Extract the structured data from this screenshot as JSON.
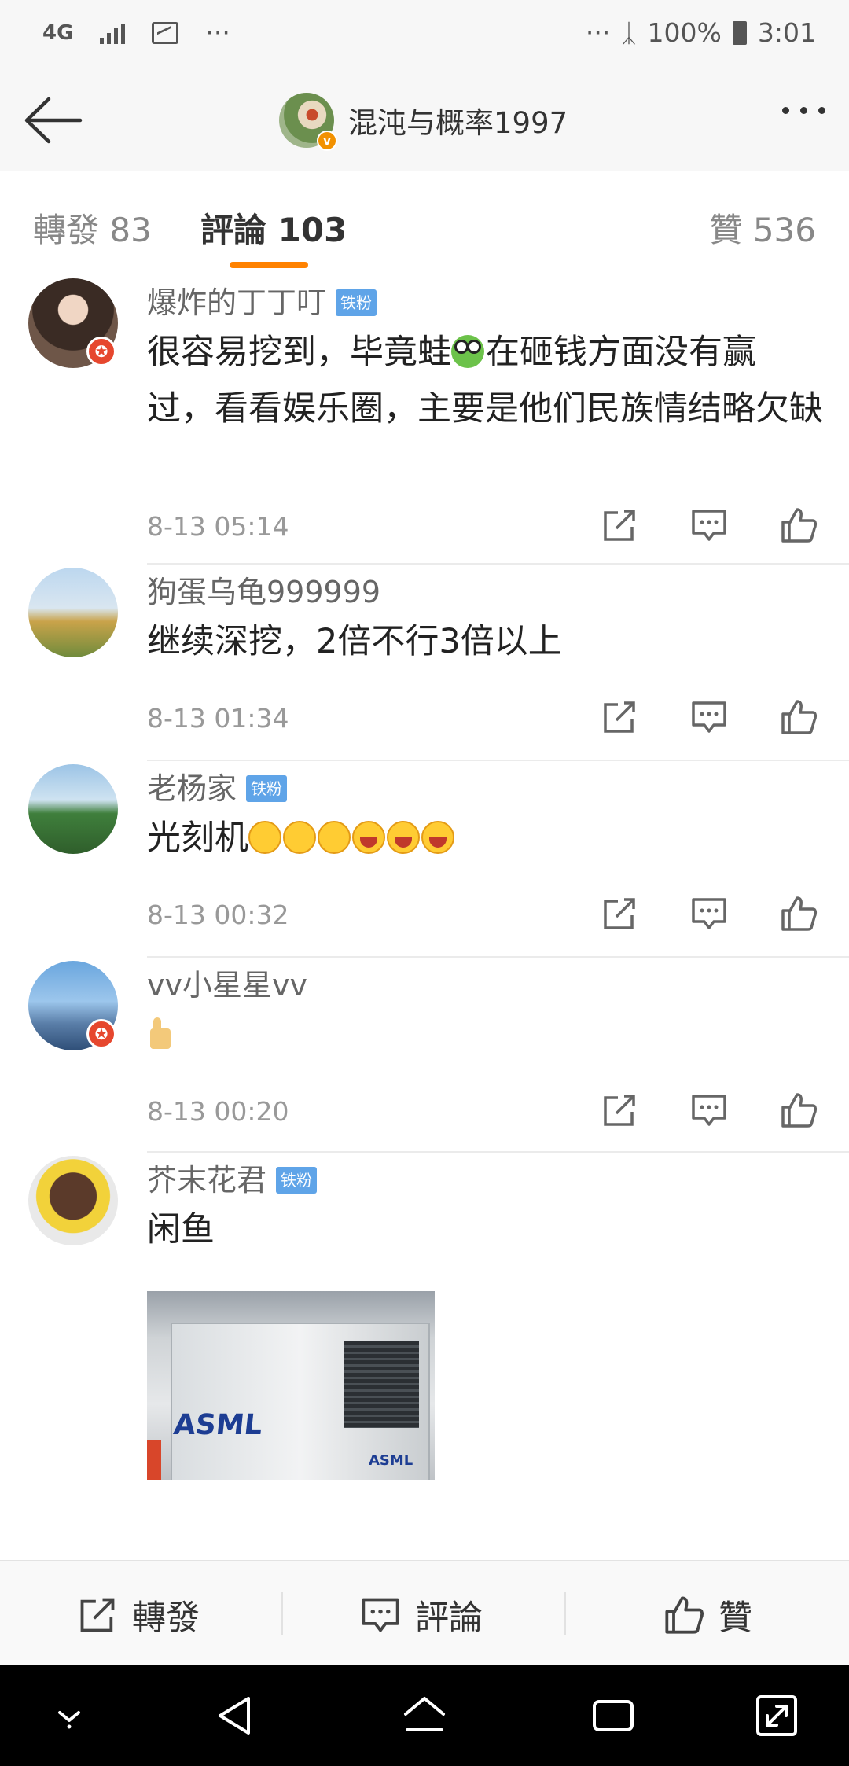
{
  "status_bar": {
    "network": "4G",
    "more": "···",
    "right_more": "···",
    "battery": "100%",
    "time": "3:01"
  },
  "header": {
    "title": "混沌与概率1997",
    "verified_mark": "v"
  },
  "tabs": [
    {
      "label": "轉發 83"
    },
    {
      "label": "評論 103"
    },
    {
      "label": "贊 536"
    }
  ],
  "comments": [
    {
      "user": "爆炸的丁丁叮",
      "badge": "铁粉",
      "text_a": "很容易挖到，毕竟蛙",
      "emoji_a": "frog",
      "text_b": "在砸钱方面没有赢过，看看娱乐圈，主要是他们民族情结略欠缺",
      "time": "8-13 05:14"
    },
    {
      "user": "狗蛋乌龟999999",
      "text": "继续深挖，2倍不行3倍以上",
      "time": "8-13 01:34"
    },
    {
      "user": "老杨家",
      "badge": "铁粉",
      "text": "光刻机",
      "emojis": [
        "cry",
        "cry",
        "cry",
        "laugh",
        "laugh",
        "laugh"
      ],
      "time": "8-13 00:32"
    },
    {
      "user": "vv小星星vv",
      "emojis": [
        "thumbs-up"
      ],
      "time": "8-13 00:20"
    },
    {
      "user": "芥末花君",
      "badge": "铁粉",
      "text": "闲鱼",
      "photo_text": "ASML",
      "photo_text_small": "ASML"
    }
  ],
  "bottom_bar": {
    "repost": "轉發",
    "comment": "評論",
    "like": "贊"
  },
  "colors": {
    "accent": "#ff8200",
    "badge_blue": "#5fa4e8",
    "verified_orange": "#f29100"
  },
  "icons": [
    "back-arrow-icon",
    "more-icon",
    "share-icon",
    "comment-icon",
    "like-icon",
    "nav-down-icon",
    "nav-back-icon",
    "nav-home-icon",
    "nav-recents-icon",
    "nav-expand-icon"
  ]
}
